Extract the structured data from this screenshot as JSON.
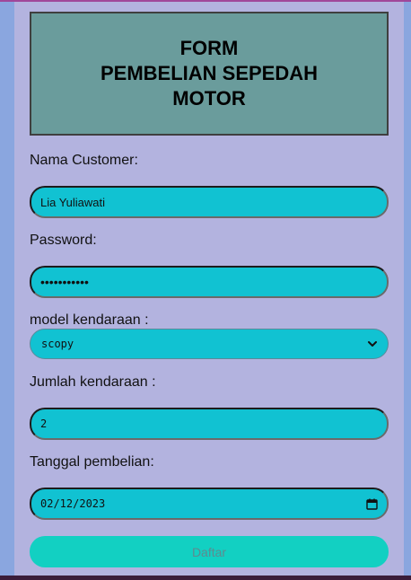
{
  "form": {
    "title_line1": "FORM",
    "title_line2": "PEMBELIAN SEPEDAH",
    "title_line3": "MOTOR",
    "customer_label": "Nama Customer:",
    "customer_value": "Lia Yuliawati",
    "password_label": "Password:",
    "password_value": "•••••••••••",
    "model_label": "model kendaraan :",
    "model_value": "scopy",
    "jumlah_label": "Jumlah kendaraan :",
    "jumlah_value": "2",
    "tanggal_label": "Tanggal pembelian:",
    "tanggal_value": "02/12/2023",
    "submit_label": "Daftar"
  },
  "colors": {
    "page_bg": "#8aa6df",
    "panel_bg": "#b3b3df",
    "header_bg": "#6a9c9c",
    "field_bg": "#11c2d2",
    "button_bg": "#12d0c2"
  },
  "icons": {
    "select_arrow": "chevron-down-icon",
    "date_picker": "calendar-icon"
  }
}
